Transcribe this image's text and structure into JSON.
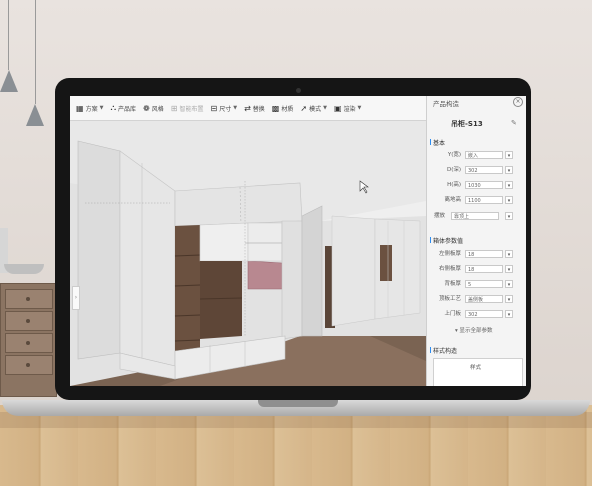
{
  "toolbar": {
    "items": [
      {
        "label": "方案",
        "icon": "scheme-icon"
      },
      {
        "label": "产品库",
        "icon": "product-library-icon"
      },
      {
        "label": "风格",
        "icon": "style-icon"
      },
      {
        "label": "智能布置",
        "icon": "smart-layout-icon"
      },
      {
        "label": "尺寸",
        "icon": "dimension-icon"
      },
      {
        "label": "替换",
        "icon": "replace-icon"
      },
      {
        "label": "材质",
        "icon": "material-icon"
      },
      {
        "label": "模式",
        "icon": "mode-icon"
      },
      {
        "label": "渲染",
        "icon": "render-icon"
      }
    ]
  },
  "panel": {
    "title": "产品构造",
    "product_name": "吊柜-S13",
    "section_basic": "基本",
    "basic_rows": [
      {
        "label": "Y(宽)",
        "value": "嵌入"
      },
      {
        "label": "D(深)",
        "value": "302"
      },
      {
        "label": "H(高)",
        "value": "1030"
      },
      {
        "label": "离地高",
        "value": "1100"
      }
    ],
    "position_label": "摆放",
    "position_value": "靠顶上",
    "section_board": "箱体参数值",
    "board_rows": [
      {
        "label": "左侧板厚",
        "value": "18"
      },
      {
        "label": "右侧板厚",
        "value": "18"
      },
      {
        "label": "背板厚",
        "value": "5"
      },
      {
        "label": "顶板工艺",
        "value": "盖侧板"
      },
      {
        "label": "上门板",
        "value": "302"
      }
    ],
    "more_label": "▾ 显示全部参数",
    "section_style": "样式构造",
    "style_label": "样式"
  }
}
